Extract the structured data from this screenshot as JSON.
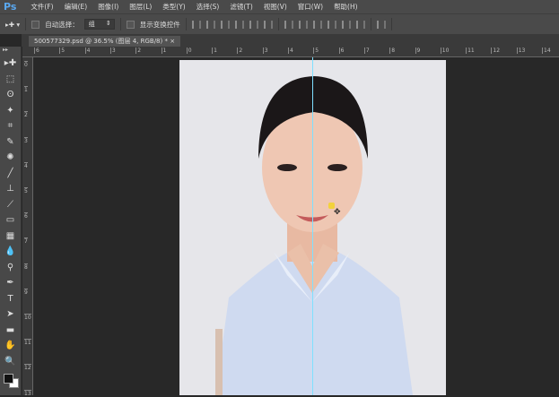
{
  "app": {
    "logo": "Ps"
  },
  "menu": [
    "文件(F)",
    "编辑(E)",
    "图像(I)",
    "图层(L)",
    "类型(Y)",
    "选择(S)",
    "滤镜(T)",
    "视图(V)",
    "窗口(W)",
    "帮助(H)"
  ],
  "options": {
    "auto_select_label": "自动选择：",
    "auto_select_value": "组",
    "show_transform_label": "显示变换控件"
  },
  "document_tab": {
    "title": "500577329.psd @ 36.5% (图层 4, RGB/8) *",
    "close": "×"
  },
  "rulers": {
    "horizontal": [
      "6",
      "5",
      "4",
      "3",
      "2",
      "1",
      "0",
      "1",
      "2",
      "3",
      "4",
      "5",
      "6",
      "7",
      "8",
      "9",
      "10",
      "11",
      "12",
      "13",
      "14"
    ],
    "vertical": [
      "0",
      "1",
      "2",
      "3",
      "4",
      "5",
      "6",
      "7",
      "8",
      "9",
      "10",
      "11",
      "12",
      "13"
    ]
  },
  "tools": [
    "move",
    "marquee",
    "lasso",
    "magic-wand",
    "crop",
    "eyedropper",
    "healing",
    "brush",
    "stamp",
    "history-brush",
    "eraser",
    "gradient",
    "blur",
    "dodge",
    "pen",
    "type",
    "path-select",
    "shape",
    "hand",
    "zoom"
  ],
  "tool_glyphs": [
    "▸✚",
    "⬚",
    "ʘ",
    "✦",
    "⌗",
    "✎",
    "✺",
    "╱",
    "⊥",
    "⟋",
    "▭",
    "▦",
    "💧",
    "⚲",
    "✒",
    "T",
    "➤",
    "▬",
    "✋",
    "🔍"
  ]
}
